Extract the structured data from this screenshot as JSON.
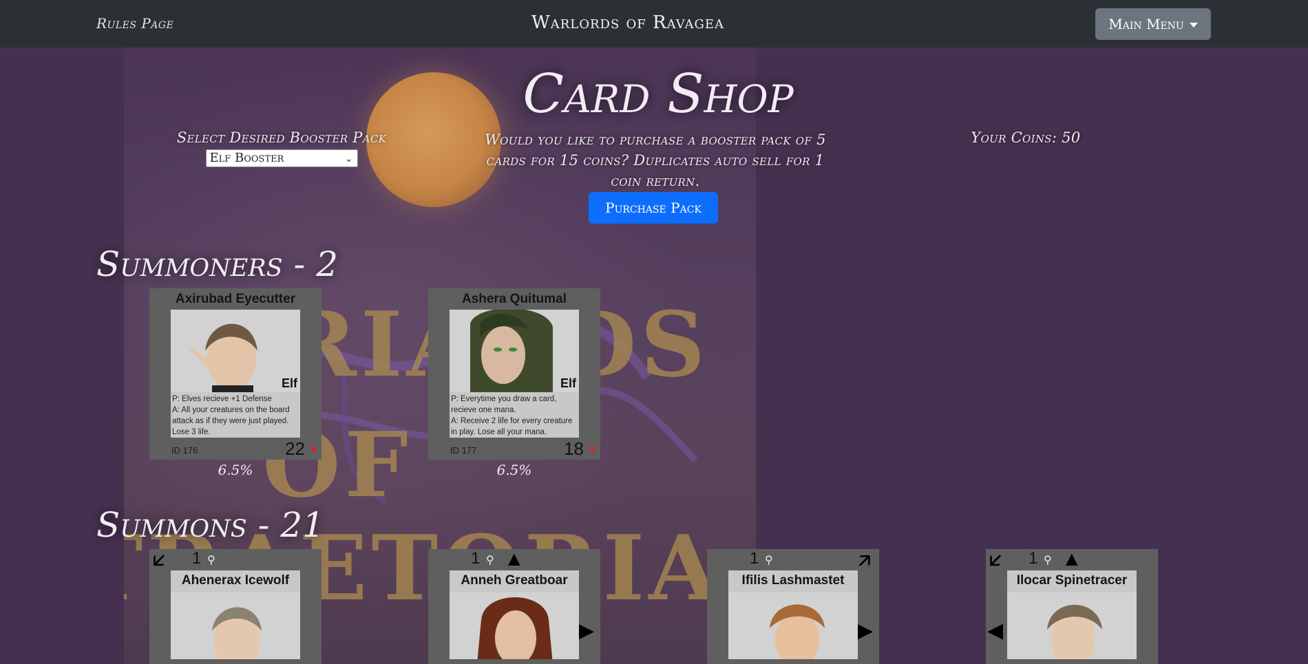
{
  "nav": {
    "rules_link": "Rules Page",
    "brand": "Warlords of Ravagea",
    "menu_label": "Main Menu"
  },
  "backdrop": {
    "title_lines": [
      "RIARDS",
      "OF",
      "TRAETORIA"
    ]
  },
  "shop": {
    "title": "Card Shop",
    "select_label": "Select Desired Booster Pack",
    "selected_pack": "Elf Booster",
    "purchase_prompt": "Would you like to purchase a booster pack of 5 cards for 15 coins? Duplicates auto sell for 1 coin return.",
    "purchase_button": "Purchase Pack",
    "coins_text": "Your Coins: 50"
  },
  "sections": {
    "summoners_title": "Summoners - 2",
    "summons_title": "Summons - 21"
  },
  "summoners": [
    {
      "name": "Axirubad Eyecutter",
      "race": "Elf",
      "text": "P: Elves recieve +1 Defense\nA: All your creatures on the board attack as if they were just played. Lose 3 life.",
      "id": "ID  176",
      "hp": "22",
      "pct": "6.5%",
      "hair": "#6e5a42",
      "skin": "#e2c4a8"
    },
    {
      "name": "Ashera Quitumal",
      "race": "Elf",
      "text": "P: Everytime you draw a card, recieve one mana.\nA: Receive 2 life for every creature in play. Lose all your mana.",
      "id": "ID  177",
      "hp": "18",
      "pct": "6.5%",
      "hair": "#3f4a2c",
      "skin": "#d8b8a0"
    }
  ],
  "summons": [
    {
      "name": "Ahenerax Icewolf",
      "cost": "1",
      "hair": "#8a8272",
      "skin": "#e4c8ae"
    },
    {
      "name": "Anneh Greatboar",
      "cost": "1",
      "hair": "#6a2c18",
      "skin": "#e2bfa2"
    },
    {
      "name": "Ifilis Lashmastet",
      "cost": "1",
      "hair": "#a86a36",
      "skin": "#e6c09c"
    },
    {
      "name": "Ilocar Spinetracer",
      "cost": "1",
      "hair": "#7a6a52",
      "skin": "#e4c8ae"
    }
  ],
  "colors": {
    "page_bg": "#46304f",
    "navbar": "#2b3035",
    "accent_button": "#0d6efd",
    "menu_button": "#6c757d",
    "card_frame": "#5f5f5f",
    "heart": "#e02020"
  },
  "icons": [
    "heart-icon",
    "mana-potion-icon",
    "chevron-down-icon",
    "arrow-icon"
  ]
}
